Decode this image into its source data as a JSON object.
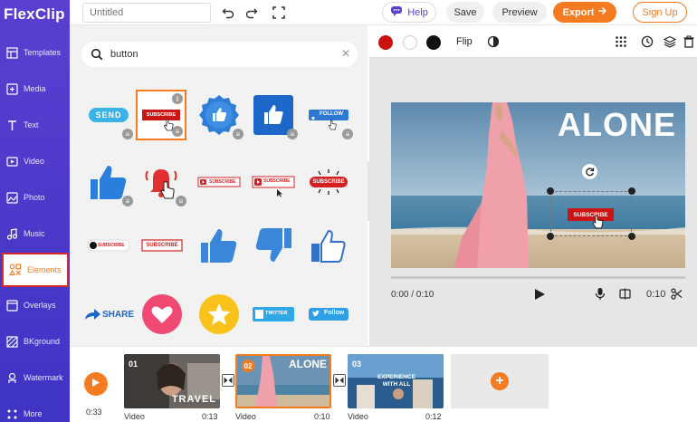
{
  "app": {
    "logo": "FlexClip"
  },
  "sidebar": {
    "items": [
      {
        "label": "Templates",
        "icon": "templates-icon"
      },
      {
        "label": "Media",
        "icon": "media-icon"
      },
      {
        "label": "Text",
        "icon": "text-icon"
      },
      {
        "label": "Video",
        "icon": "video-icon"
      },
      {
        "label": "Photo",
        "icon": "photo-icon"
      },
      {
        "label": "Music",
        "icon": "music-icon"
      },
      {
        "label": "Elements",
        "icon": "elements-icon",
        "active": true
      },
      {
        "label": "Overlays",
        "icon": "overlays-icon"
      },
      {
        "label": "BKground",
        "icon": "background-icon"
      },
      {
        "label": "Watermark",
        "icon": "watermark-icon"
      },
      {
        "label": "More",
        "icon": "more-icon"
      }
    ]
  },
  "topbar": {
    "title_placeholder": "Untitled",
    "help": "Help",
    "save": "Save",
    "preview": "Preview",
    "export": "Export",
    "signup": "Sign Up"
  },
  "panel": {
    "search_value": "button",
    "element_texts": {
      "send": "SEND",
      "subscribe": "SUBSCRIBE",
      "follow": "FOLLOW",
      "share": "SHARE",
      "twitter": "TWITTER",
      "follow2": "Follow"
    }
  },
  "preview": {
    "flip": "Flip",
    "canvas_title": "ALONE",
    "canvas_button": "SUBSCRIBE",
    "time": "0:00 / 0:10",
    "end_time": "0:10",
    "colors": {
      "red": "#cc1111",
      "white": "#ffffff",
      "black": "#111111"
    }
  },
  "timeline": {
    "total": "0:33",
    "clips": [
      {
        "num": "01",
        "overlay": "TRAVEL",
        "label": "Video",
        "duration": "0:13"
      },
      {
        "num": "02",
        "overlay": "ALONE",
        "label": "Video",
        "duration": "0:10"
      },
      {
        "num": "03",
        "overlay": "EXPERIENCE WITH ALL",
        "label": "Video",
        "duration": "0:12"
      }
    ]
  },
  "colors": {
    "accent": "#f47b20",
    "brand": "#4a3acb"
  }
}
